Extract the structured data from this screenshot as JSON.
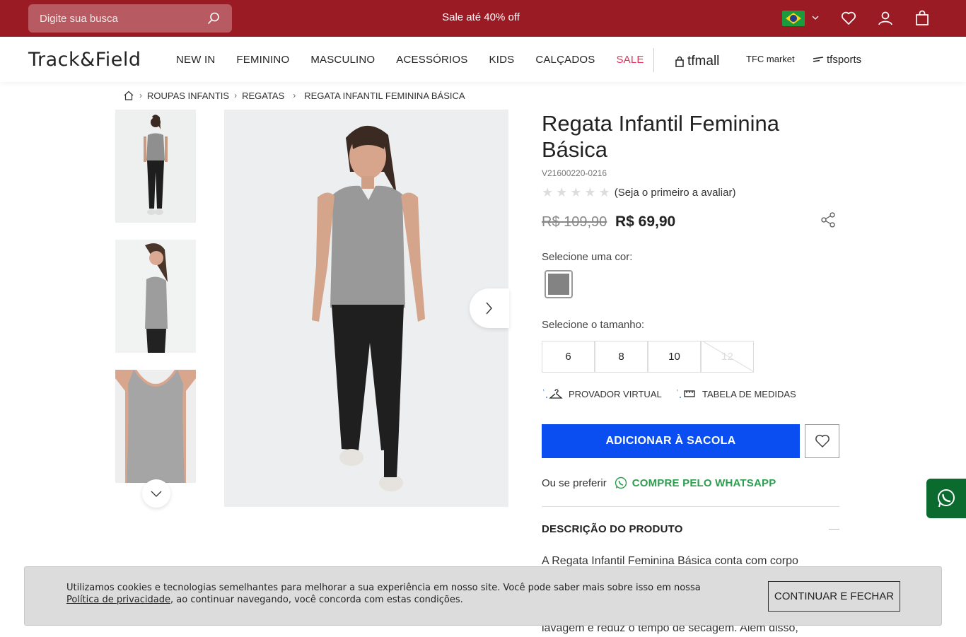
{
  "topbar": {
    "search_placeholder": "Digite sua busca",
    "promo": "Sale até 40% off",
    "icons": [
      "search-icon",
      "brazil-flag-icon",
      "chevron-down-icon",
      "heart-icon",
      "user-icon",
      "bag-icon"
    ],
    "colors": {
      "bar": "#9b1b25"
    }
  },
  "nav": {
    "logo": "Track&Field",
    "items": [
      "NEW IN",
      "FEMININO",
      "MASCULINO",
      "ACESSÓRIOS",
      "KIDS",
      "CALÇADOS",
      "SALE"
    ],
    "brands": [
      "tfmall",
      "TFC market",
      "tfsports"
    ],
    "sale_color": "#e2345a"
  },
  "breadcrumb": [
    "ROUPAS INFANTIS",
    "REGATAS",
    "REGATA INFANTIL FEMININA BÁSICA"
  ],
  "product": {
    "title": "Regata Infantil Feminina Básica",
    "sku": "V21600220-0216",
    "rating_text": "(Seja o primeiro a avaliar)",
    "old_price": "R$ 109,90",
    "price": "R$ 69,90",
    "color_label": "Selecione uma cor:",
    "size_label": "Selecione o tamanho:",
    "sizes": [
      "6",
      "8",
      "10",
      "12"
    ],
    "disabled_size": "12",
    "swatch_color": "#838383",
    "tools": {
      "virtual_fitting": "PROVADOR VIRTUAL",
      "size_chart": "TABELA DE MEDIDAS"
    },
    "add_to_bag": "ADICIONAR À SACOLA",
    "whatsapp_prefix": "Ou se preferir",
    "whatsapp_link": "COMPRE PELO WHATSAPP",
    "description_heading": "DESCRIÇÃO DO PRODUTO",
    "description_line1": "A Regata Infantil Feminina Básica conta com corpo",
    "description_line2": "lavagem e reduz o tempo de secagem. Além disso,",
    "accent_blue": "#0a4df0"
  },
  "cookie": {
    "text": "Utilizamos cookies e tecnologias semelhantes para melhorar a sua experiência em nosso site. Você pode saber mais sobre isso em nossa",
    "link": "Política de privacidade",
    "text_after": ", ao continuar navegando, você concorda com estas condições.",
    "button": "CONTINUAR E FECHAR"
  }
}
